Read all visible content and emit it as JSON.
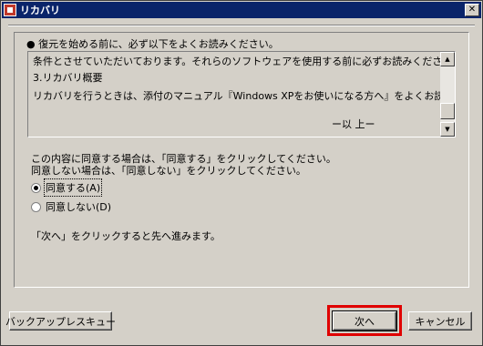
{
  "window": {
    "title": "リカバリ",
    "close_glyph": "✕"
  },
  "content": {
    "intro": "● 復元を始める前に、必ず以下をよくお読みください。",
    "textbox_lines": [
      "条件とさせていただいております。それらのソフトウェアを使用する前に必ずお読みください。",
      "3.リカバリ概要",
      "リカバリを行うときは、添付のマニュアル『Windows XPをお使いになる方へ』をよくお読みになってご使用ください。",
      "ー以 上ー"
    ],
    "instruction_line1": "この内容に同意する場合は、「同意する」をクリックしてください。",
    "instruction_line2": "同意しない場合は、「同意しない」をクリックしてください。",
    "options": [
      {
        "label": "同意する(A)",
        "selected": true
      },
      {
        "label": "同意しない(D)",
        "selected": false
      }
    ],
    "hint": "「次へ」をクリックすると先へ進みます。"
  },
  "buttons": {
    "backup_rescue": "バックアップレスキュー",
    "next": "次へ",
    "cancel": "キャンセル"
  },
  "colors": {
    "titlebar": "#0a246a",
    "face": "#d4d0c8",
    "highlight": "#e00000"
  }
}
